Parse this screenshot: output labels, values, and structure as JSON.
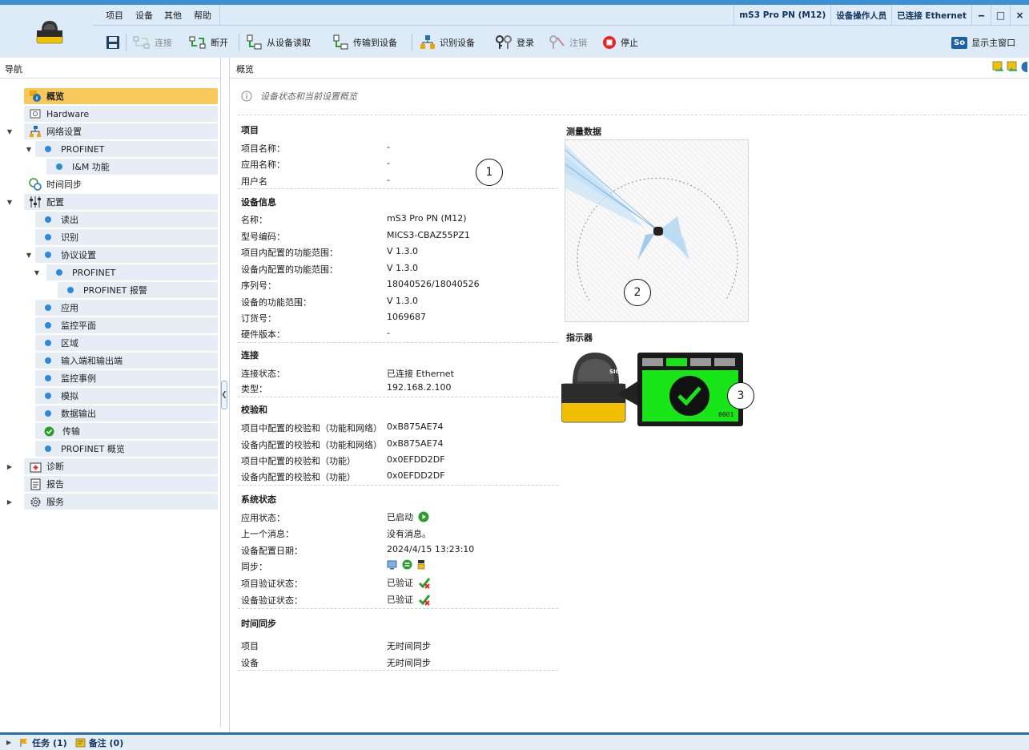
{
  "menu": [
    "项目",
    "设备",
    "其他",
    "帮助"
  ],
  "status": {
    "device": "mS3 Pro PN (M12)",
    "user": "设备操作人员",
    "connection": "已连接 Ethernet"
  },
  "window_buttons": {
    "minimize": "‒",
    "maximize": "□",
    "close": "×"
  },
  "toolbar": {
    "connect": "连接",
    "disconnect": "断开",
    "read_device": "从设备读取",
    "transfer": "传输到设备",
    "identify": "识别设备",
    "login": "登录",
    "logout": "注销",
    "stop": "停止",
    "show_main": "显示主窗口",
    "show_main_badge": "So"
  },
  "nav": {
    "title": "导航",
    "items": [
      {
        "label": "概览"
      },
      {
        "label": "Hardware"
      },
      {
        "label": "网络设置"
      },
      {
        "label": "PROFINET"
      },
      {
        "label": "I&M 功能"
      },
      {
        "label": "时间同步"
      },
      {
        "label": "配置"
      },
      {
        "label": "读出"
      },
      {
        "label": "识别"
      },
      {
        "label": "协议设置"
      },
      {
        "label": "PROFINET"
      },
      {
        "label": "PROFINET 报警"
      },
      {
        "label": "应用"
      },
      {
        "label": "监控平面"
      },
      {
        "label": "区域"
      },
      {
        "label": "输入端和输出端"
      },
      {
        "label": "监控事例"
      },
      {
        "label": "模拟"
      },
      {
        "label": "数据输出"
      },
      {
        "label": "传输"
      },
      {
        "label": "PROFINET 概览"
      },
      {
        "label": "诊断"
      },
      {
        "label": "报告"
      },
      {
        "label": "服务"
      }
    ]
  },
  "main": {
    "title": "概览",
    "description": "设备状态和当前设置概览",
    "project": {
      "title": "项目",
      "rows": [
        {
          "label": "项目名称：",
          "value": "-"
        },
        {
          "label": "应用名称：",
          "value": "-"
        },
        {
          "label": "用户名",
          "value": "-"
        }
      ]
    },
    "device_info": {
      "title": "设备信息",
      "rows": [
        {
          "label": "名称：",
          "value": "mS3 Pro PN (M12)"
        },
        {
          "label": "型号编码：",
          "value": "MICS3-CBAZ55PZ1"
        },
        {
          "label": "项目内配置的功能范围：",
          "value": "V 1.3.0"
        },
        {
          "label": "设备内配置的功能范围：",
          "value": "V 1.3.0"
        },
        {
          "label": "序列号：",
          "value": "18040526/18040526"
        },
        {
          "label": "设备的功能范围：",
          "value": "V 1.3.0"
        },
        {
          "label": "订货号：",
          "value": "1069687"
        },
        {
          "label": "硬件版本：",
          "value": "-"
        }
      ]
    },
    "connection": {
      "title": "连接",
      "rows": [
        {
          "label": "连接状态：",
          "value": "已连接 Ethernet"
        },
        {
          "label": "类型：",
          "value": "192.168.2.100"
        }
      ]
    },
    "checksum": {
      "title": "校验和",
      "rows": [
        {
          "label": "项目中配置的校验和（功能和网络）",
          "value": "0xB875AE74"
        },
        {
          "label": "设备内配置的校验和（功能和网络）",
          "value": "0xB875AE74"
        },
        {
          "label": "项目中配置的校验和（功能）",
          "value": "0x0EFDD2DF"
        },
        {
          "label": "设备内配置的校验和（功能）",
          "value": "0x0EFDD2DF"
        }
      ]
    },
    "system_status": {
      "title": "系统状态",
      "rows": [
        {
          "label": "应用状态：",
          "value": "已启动"
        },
        {
          "label": "上一个消息：",
          "value": "没有消息。"
        },
        {
          "label": "设备配置日期：",
          "value": "2024/4/15 13:23:10"
        },
        {
          "label": "同步：",
          "value": ""
        },
        {
          "label": "项目验证状态：",
          "value": "已验证"
        },
        {
          "label": "设备验证状态：",
          "value": "已验证"
        }
      ]
    },
    "time_sync": {
      "title": "时间同步",
      "rows": [
        {
          "label": "项目",
          "value": "无时间同步"
        },
        {
          "label": "设备",
          "value": "无时间同步"
        }
      ]
    },
    "measurement_title": "测量数据",
    "indicator_title": "指示器",
    "indicator_code": "0001",
    "device_brand": "SICK",
    "callouts": [
      "1",
      "2",
      "3"
    ],
    "colors": {
      "accent": "#3c8fd0",
      "selected": "#f8c85c",
      "indicator_green": "#19e619"
    }
  },
  "bottom": {
    "tasks": "任务 (1)",
    "notes": "备注 (0)"
  }
}
